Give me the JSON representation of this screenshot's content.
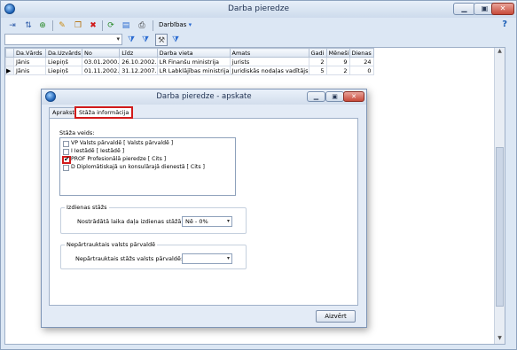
{
  "window": {
    "title": "Darba pieredze"
  },
  "toolbar": {
    "menu_label": "Darbības",
    "help": "?"
  },
  "grid": {
    "columns": [
      "Da.Vārds",
      "Da.Uzvārds",
      "No",
      "Līdz",
      "Darba vieta",
      "Amats",
      "Gadi",
      "Mēneši",
      "Dienas"
    ],
    "rows": [
      {
        "vards": "Jānis",
        "uzvards": "Liepiņš",
        "no": "03.01.2000.",
        "lidz": "26.10.2002.",
        "vieta": "LR Finanšu ministrija",
        "amats": "jurists",
        "gadi": "2",
        "menesi": "9",
        "dienas": "24"
      },
      {
        "vards": "Jānis",
        "uzvards": "Liepiņš",
        "no": "01.11.2002.",
        "lidz": "31.12.2007.",
        "vieta": "LR Labklājības ministrija",
        "amats": "Juridiskās nodaļas vadītājs",
        "gadi": "5",
        "menesi": "2",
        "dienas": "0"
      }
    ]
  },
  "dialog": {
    "title": "Darba pieredze - apskate",
    "tabs": [
      "Apraksts",
      "Stāža informācija"
    ],
    "staza_veids_label": "Stāža veids:",
    "stazu_list": [
      {
        "label": "VP Valsts pārvaldē [ Valsts pārvaldē ]",
        "checked": false
      },
      {
        "label": "I Iestādē [ Iestādē ]",
        "checked": false
      },
      {
        "label": "PROF Profesionālā pieredze [ Cits ]",
        "checked": true
      },
      {
        "label": "D Diplomātiskajā un konsulārajā dienestā [ Cits ]",
        "checked": false
      }
    ],
    "izdienas_group": "Izdienas stāžs",
    "izdienas_label": "Nostrādātā laika daļa izdienas stāžā:",
    "izdienas_value": "Nē - 0%",
    "nepartraukts_group": "Nepārtrauktais valsts pārvaldē",
    "nepartraukts_label": "Nepārtrauktais stāžs valsts pārvaldē:",
    "nepartraukts_value": "",
    "close_button": "Aizvērt"
  }
}
